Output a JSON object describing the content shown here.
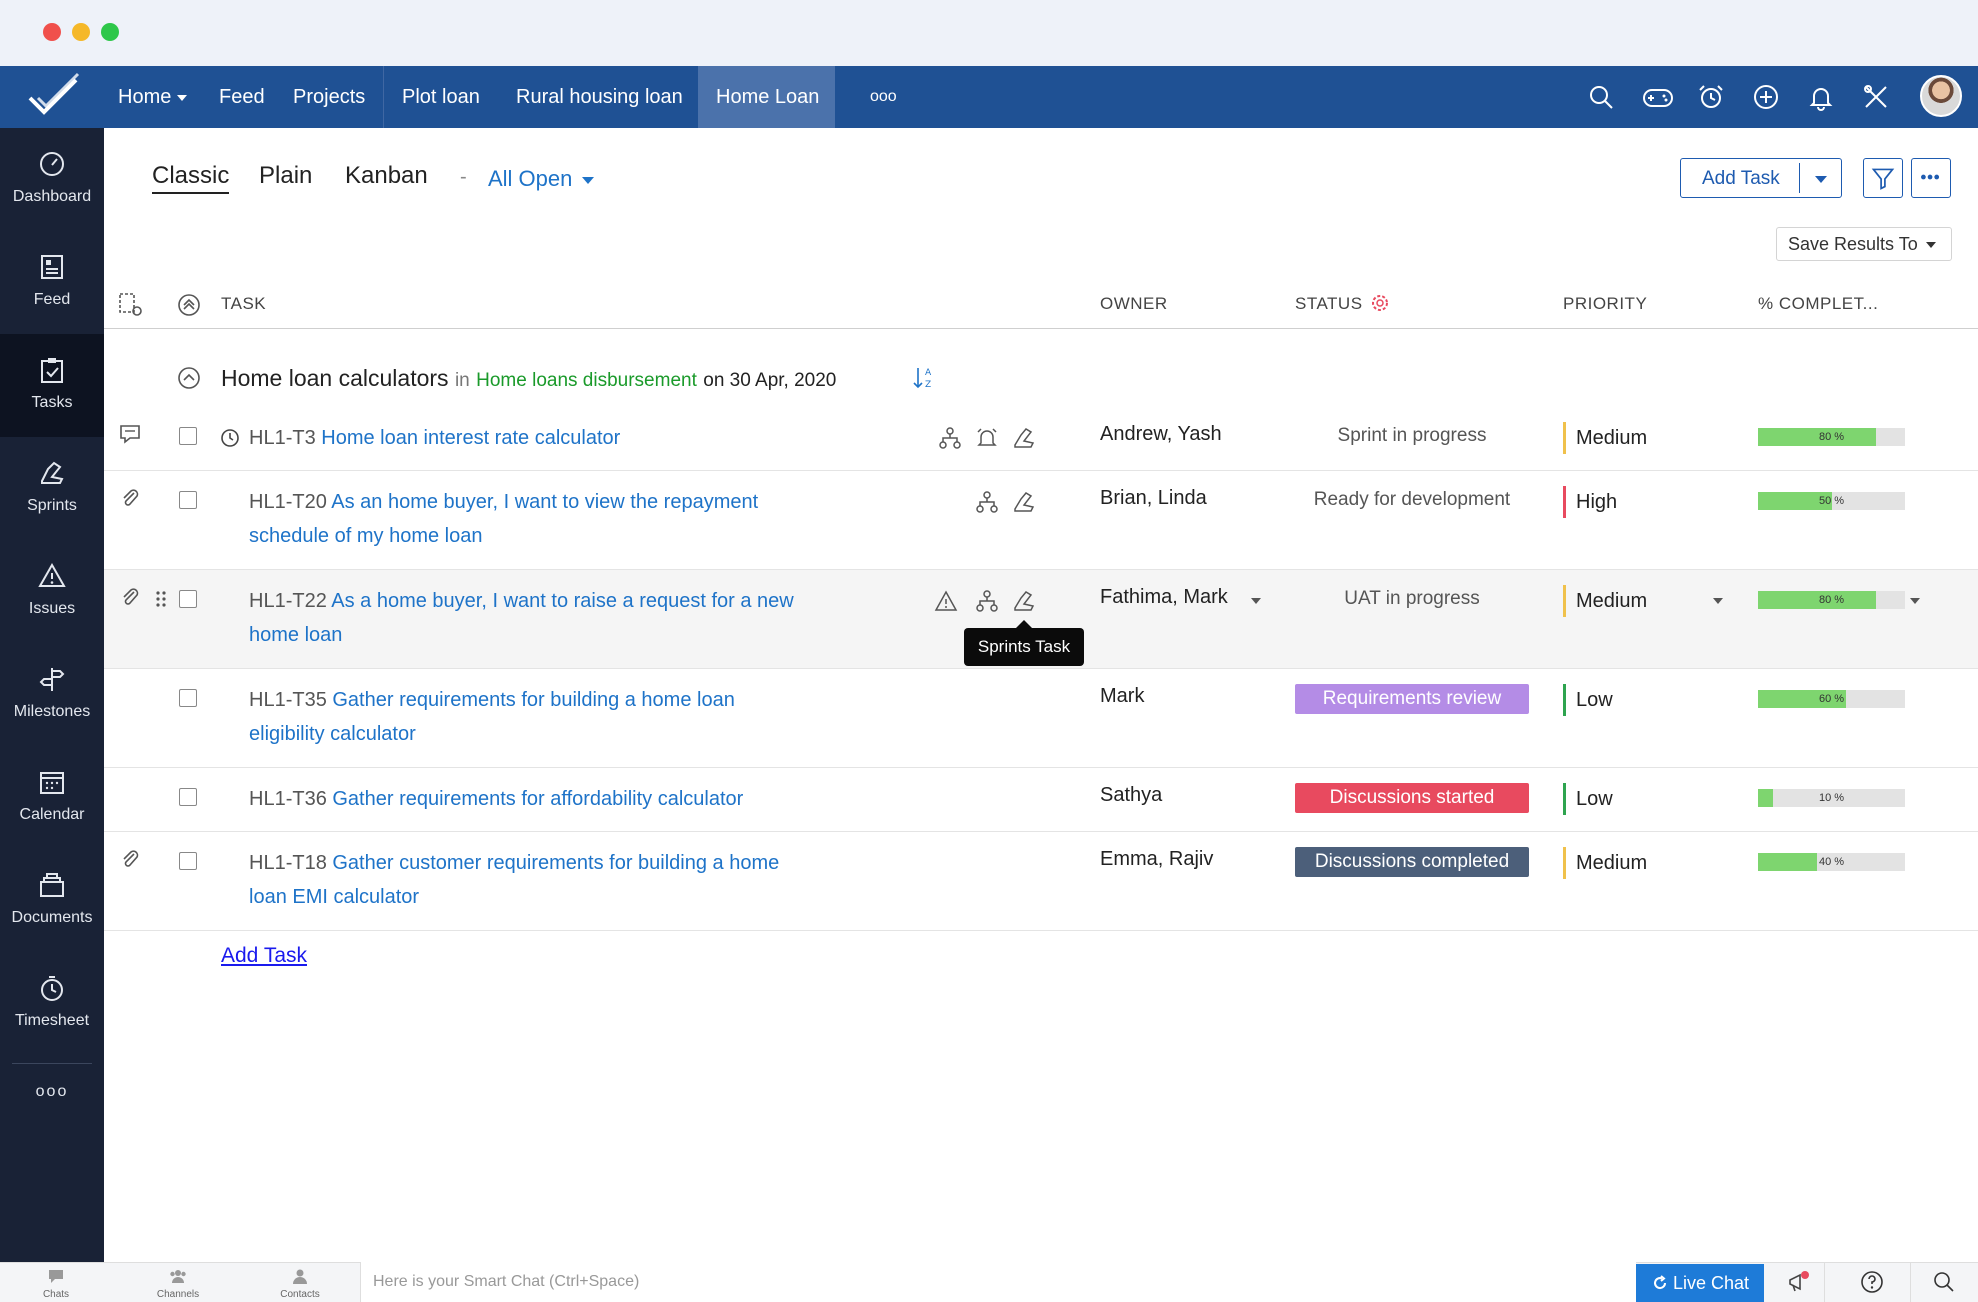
{
  "nav": {
    "items": [
      {
        "label": "Home",
        "has_caret": true
      },
      {
        "label": "Feed"
      },
      {
        "label": "Projects"
      },
      {
        "label": "Plot loan"
      },
      {
        "label": "Rural housing loan"
      },
      {
        "label": "Home Loan",
        "active": true
      },
      {
        "label": "ooo"
      }
    ],
    "icons": [
      "search-icon",
      "gamepad-icon",
      "alarm-clock-icon",
      "add-circle-icon",
      "bell-icon",
      "tools-icon",
      "user-avatar"
    ]
  },
  "sidebar": {
    "items": [
      {
        "label": "Dashboard",
        "icon": "gauge-icon"
      },
      {
        "label": "Feed",
        "icon": "feed-icon"
      },
      {
        "label": "Tasks",
        "icon": "clipboard-check-icon",
        "active": true
      },
      {
        "label": "Sprints",
        "icon": "sprint-shoe-icon"
      },
      {
        "label": "Issues",
        "icon": "warning-icon"
      },
      {
        "label": "Milestones",
        "icon": "signpost-icon"
      },
      {
        "label": "Calendar",
        "icon": "calendar-icon"
      },
      {
        "label": "Documents",
        "icon": "documents-icon"
      },
      {
        "label": "Timesheet",
        "icon": "stopwatch-icon"
      }
    ],
    "more": "ooo"
  },
  "views": {
    "tabs": [
      "Classic",
      "Plain",
      "Kanban"
    ],
    "active": "Classic",
    "separator": "-",
    "filter": "All Open"
  },
  "toolbar": {
    "add_task": "Add Task",
    "save_results": "Save Results To"
  },
  "table": {
    "headers": {
      "task": "TASK",
      "owner": "OWNER",
      "status": "STATUS",
      "priority": "PRIORITY",
      "complete": "% COMPLET..."
    }
  },
  "group": {
    "name": "Home loan calculators",
    "in_word": "in",
    "tasklist": "Home loans disbursement",
    "on_date": "on 30 Apr, 2020"
  },
  "tasks": [
    {
      "id": "HL1-T3",
      "title": "Home loan interest rate calculator",
      "owner": "Andrew, Yash",
      "status": "Sprint in progress",
      "priority": "Medium",
      "percent": 80,
      "percent_label": "80 %"
    },
    {
      "id": "HL1-T20",
      "title_line1": "As an home buyer, I want to view the repayment",
      "title_line2": "schedule of my home loan",
      "owner": "Brian, Linda",
      "status": "Ready for development",
      "priority": "High",
      "percent": 50,
      "percent_label": "50 %"
    },
    {
      "id": "HL1-T22",
      "title_line1": "As a home buyer, I want to raise a request for a new",
      "title_line2": "home loan",
      "owner": "Fathima, Mark",
      "status": "UAT in progress",
      "priority": "Medium",
      "percent": 80,
      "percent_label": "80 %"
    },
    {
      "id": "HL1-T35",
      "title_line1": "Gather requirements for building a home loan",
      "title_line2": "eligibility calculator",
      "owner": "Mark",
      "status": "Requirements review",
      "status_color": "#b48ce6",
      "priority": "Low",
      "percent": 60,
      "percent_label": "60 %"
    },
    {
      "id": "HL1-T36",
      "title": "Gather requirements for affordability calculator",
      "owner": "Sathya",
      "status": "Discussions started",
      "status_color": "#e84a5f",
      "priority": "Low",
      "percent": 10,
      "percent_label": "10 %"
    },
    {
      "id": "HL1-T18",
      "title_line1": "Gather customer requirements for building a home",
      "title_line2": "loan EMI calculator",
      "owner": "Emma, Rajiv",
      "status": "Discussions completed",
      "status_color": "#4c5f7a",
      "priority": "Medium",
      "percent": 40,
      "percent_label": "40 %"
    }
  ],
  "tooltip": "Sprints Task",
  "add_task_link": "Add Task",
  "bottom": {
    "chats": "Chats",
    "channels": "Channels",
    "contacts": "Contacts",
    "smart_chat_placeholder": "Here is your Smart Chat (Ctrl+Space)",
    "live_chat": "Live Chat"
  },
  "colors": {
    "nav_bg": "#1f5194",
    "sidebar_bg": "#192236",
    "link": "#1e73c8",
    "progress": "#7ed56f"
  }
}
